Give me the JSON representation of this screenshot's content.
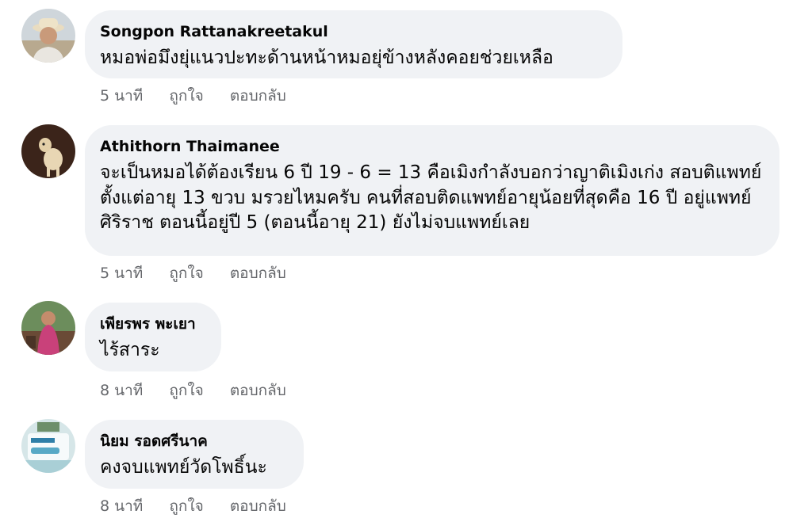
{
  "comments": [
    {
      "author": "Songpon Rattanakreetakul",
      "text": "หมอพ่อมึงยุ่แนวปะทะด้านหน้าหมอยุ่ข้างหลังคอยช่วยเหลือ",
      "time": "5 นาที",
      "like": "ถูกใจ",
      "reply": "ตอบกลับ"
    },
    {
      "author": "Athithorn Thaimanee",
      "text": "จะเป็นหมอได้ต้องเรียน 6 ปี 19 - 6 = 13 คือเมิงกำลังบอกว่าญาติเมิงเก่ง สอบติแพทย์ตั้งแต่อายุ 13 ขวบ มรวยไหมครับ คนที่สอบติดแพทย์อายุน้อยที่สุดคือ 16 ปี อยู่แพทย์ศิริราช ตอนนี้อยู่ปี 5 (ตอนนี้อายุ 21) ยังไม่จบแพทย์เลย",
      "time": "5 นาที",
      "like": "ถูกใจ",
      "reply": "ตอบกลับ"
    },
    {
      "author": "เพียรพร พะเยา",
      "text": "ไร้สาระ",
      "time": "8 นาที",
      "like": "ถูกใจ",
      "reply": "ตอบกลับ"
    },
    {
      "author": "นิยม รอดศรีนาค",
      "text": "คงจบแพทย์วัดโพธิ์นะ",
      "time": "8 นาที",
      "like": "ถูกใจ",
      "reply": "ตอบกลับ"
    }
  ],
  "colors": {
    "bubble_bg": "#f0f2f5",
    "text": "#050505",
    "meta": "#65676b"
  }
}
